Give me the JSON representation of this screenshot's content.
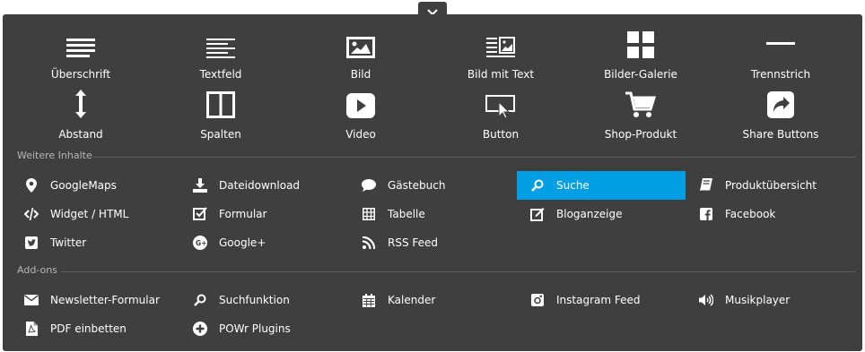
{
  "main_elements": [
    {
      "label": "Überschrift",
      "icon": "heading-icon"
    },
    {
      "label": "Textfeld",
      "icon": "text-field-icon"
    },
    {
      "label": "Bild",
      "icon": "image-icon"
    },
    {
      "label": "Bild mit Text",
      "icon": "image-with-text-icon"
    },
    {
      "label": "Bilder-Galerie",
      "icon": "gallery-icon"
    },
    {
      "label": "Trennstrich",
      "icon": "divider-icon"
    },
    {
      "label": "Abstand",
      "icon": "spacing-icon"
    },
    {
      "label": "Spalten",
      "icon": "columns-icon"
    },
    {
      "label": "Video",
      "icon": "video-icon"
    },
    {
      "label": "Button",
      "icon": "button-icon"
    },
    {
      "label": "Shop-Produkt",
      "icon": "shopping-cart-icon"
    },
    {
      "label": "Share Buttons",
      "icon": "share-icon"
    }
  ],
  "more_content": {
    "title": "Weitere Inhalte",
    "items": [
      {
        "label": "GoogleMaps",
        "icon": "map-marker-icon"
      },
      {
        "label": "Dateidownload",
        "icon": "download-icon"
      },
      {
        "label": "Gästebuch",
        "icon": "speech-bubble-icon"
      },
      {
        "label": "Suche",
        "icon": "search-icon",
        "active": true
      },
      {
        "label": "Produktübersicht",
        "icon": "book-icon"
      },
      {
        "label": "Widget / HTML",
        "icon": "code-icon"
      },
      {
        "label": "Formular",
        "icon": "checkbox-icon"
      },
      {
        "label": "Tabelle",
        "icon": "table-icon"
      },
      {
        "label": "Bloganzeige",
        "icon": "edit-icon"
      },
      {
        "label": "Facebook",
        "icon": "facebook-icon"
      },
      {
        "label": "Twitter",
        "icon": "twitter-icon"
      },
      {
        "label": "Google+",
        "icon": "google-plus-icon"
      },
      {
        "label": "RSS Feed",
        "icon": "rss-icon"
      }
    ]
  },
  "addons": {
    "title": "Add-ons",
    "items": [
      {
        "label": "Newsletter-Formular",
        "icon": "envelope-icon"
      },
      {
        "label": "Suchfunktion",
        "icon": "search-icon"
      },
      {
        "label": "Kalender",
        "icon": "calendar-icon"
      },
      {
        "label": "Instagram Feed",
        "icon": "instagram-icon"
      },
      {
        "label": "Musikplayer",
        "icon": "speaker-icon"
      },
      {
        "label": "PDF einbetten",
        "icon": "pdf-icon"
      },
      {
        "label": "POWr Plugins",
        "icon": "plus-circle-icon"
      }
    ]
  },
  "colors": {
    "panel": "#3f3f3f",
    "active": "#009fe3",
    "text": "#ffffff",
    "section": "#b5b5b5"
  }
}
